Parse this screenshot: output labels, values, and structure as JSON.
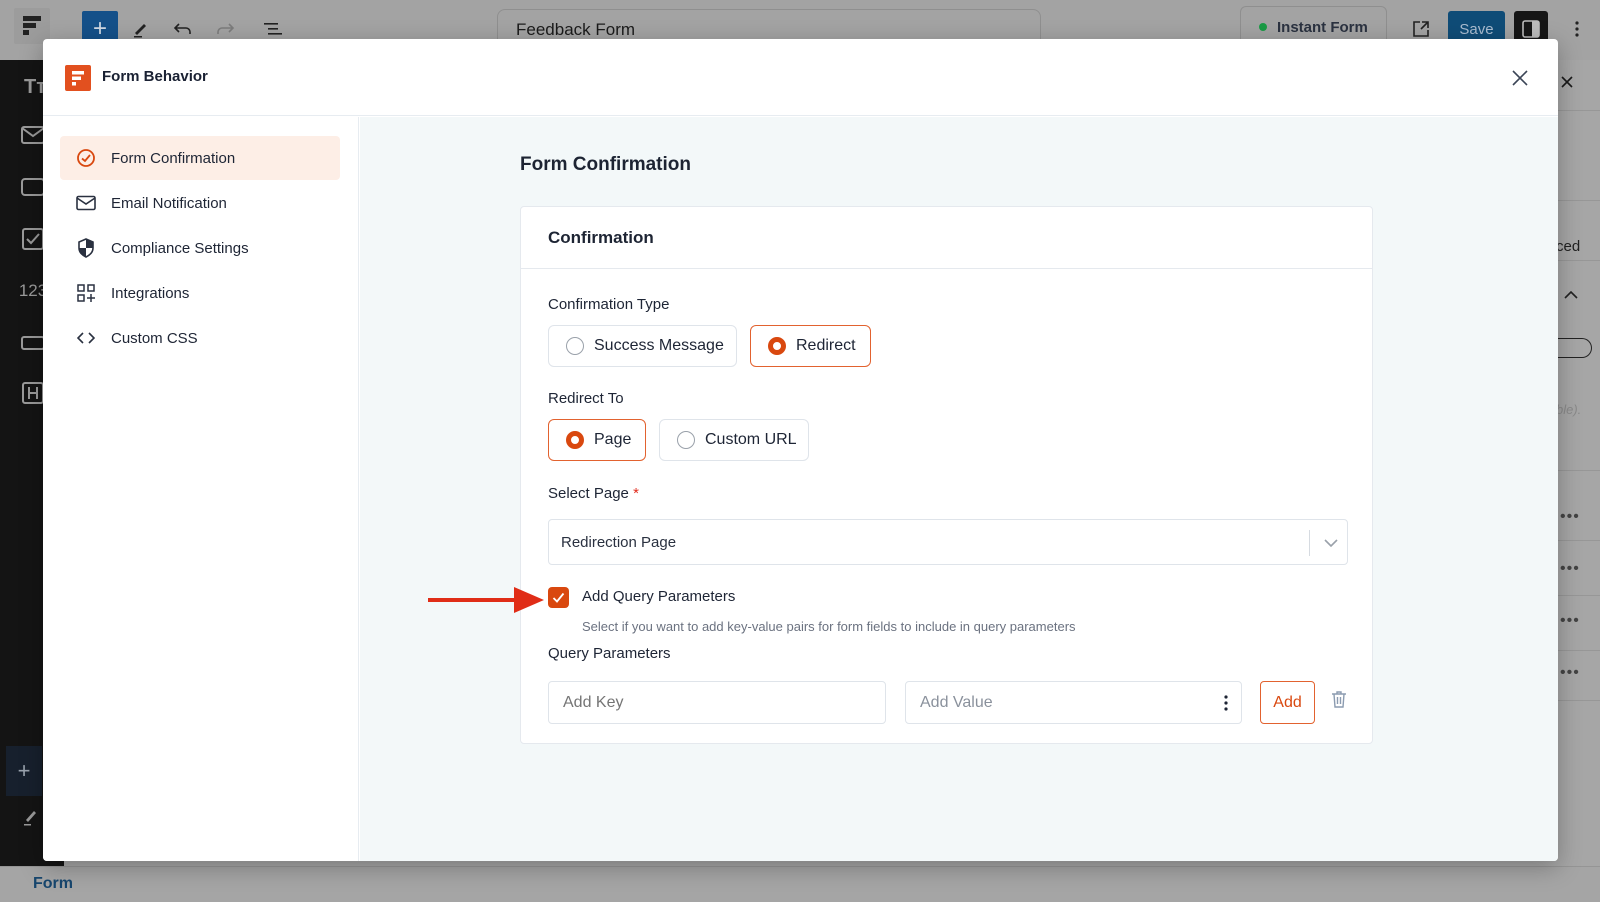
{
  "background": {
    "document_title": "Feedback Form",
    "status_label": "Instant Form",
    "status_color": "#1a9b45",
    "save_label": "Save",
    "left_tools": [
      "text-icon",
      "mail-icon",
      "textarea-icon",
      "checkbox-icon",
      "number-icon",
      "button-icon",
      "heading-icon"
    ],
    "number_tool_label": "123",
    "right_panel_fragments": [
      "ced",
      "ble)."
    ],
    "bottom_label": "Form"
  },
  "modal": {
    "title": "Form Behavior",
    "brand_color": "#e2501f",
    "nav": [
      {
        "label": "Form Confirmation",
        "icon": "check-circle-icon",
        "active": true
      },
      {
        "label": "Email Notification",
        "icon": "mail-icon",
        "active": false
      },
      {
        "label": "Compliance Settings",
        "icon": "shield-icon",
        "active": false
      },
      {
        "label": "Integrations",
        "icon": "grid-plus-icon",
        "active": false
      },
      {
        "label": "Custom CSS",
        "icon": "code-icon",
        "active": false
      }
    ],
    "content": {
      "title": "Form Confirmation",
      "card_title": "Confirmation",
      "confirmation_type": {
        "label": "Confirmation Type",
        "options": [
          {
            "label": "Success Message",
            "selected": false
          },
          {
            "label": "Redirect",
            "selected": true
          }
        ]
      },
      "redirect_to": {
        "label": "Redirect To",
        "options": [
          {
            "label": "Page",
            "selected": true
          },
          {
            "label": "Custom URL",
            "selected": false
          }
        ]
      },
      "select_page": {
        "label": "Select Page",
        "required_mark": "*",
        "value": "Redirection Page"
      },
      "query_params_toggle": {
        "label": "Add Query Parameters",
        "checked": true,
        "help": "Select if you want to add key-value pairs for form fields to include in query parameters"
      },
      "query_params": {
        "label": "Query Parameters",
        "key_placeholder": "Add Key",
        "value_placeholder": "Add Value",
        "add_label": "Add"
      }
    },
    "accent_color": "#d9480f"
  }
}
